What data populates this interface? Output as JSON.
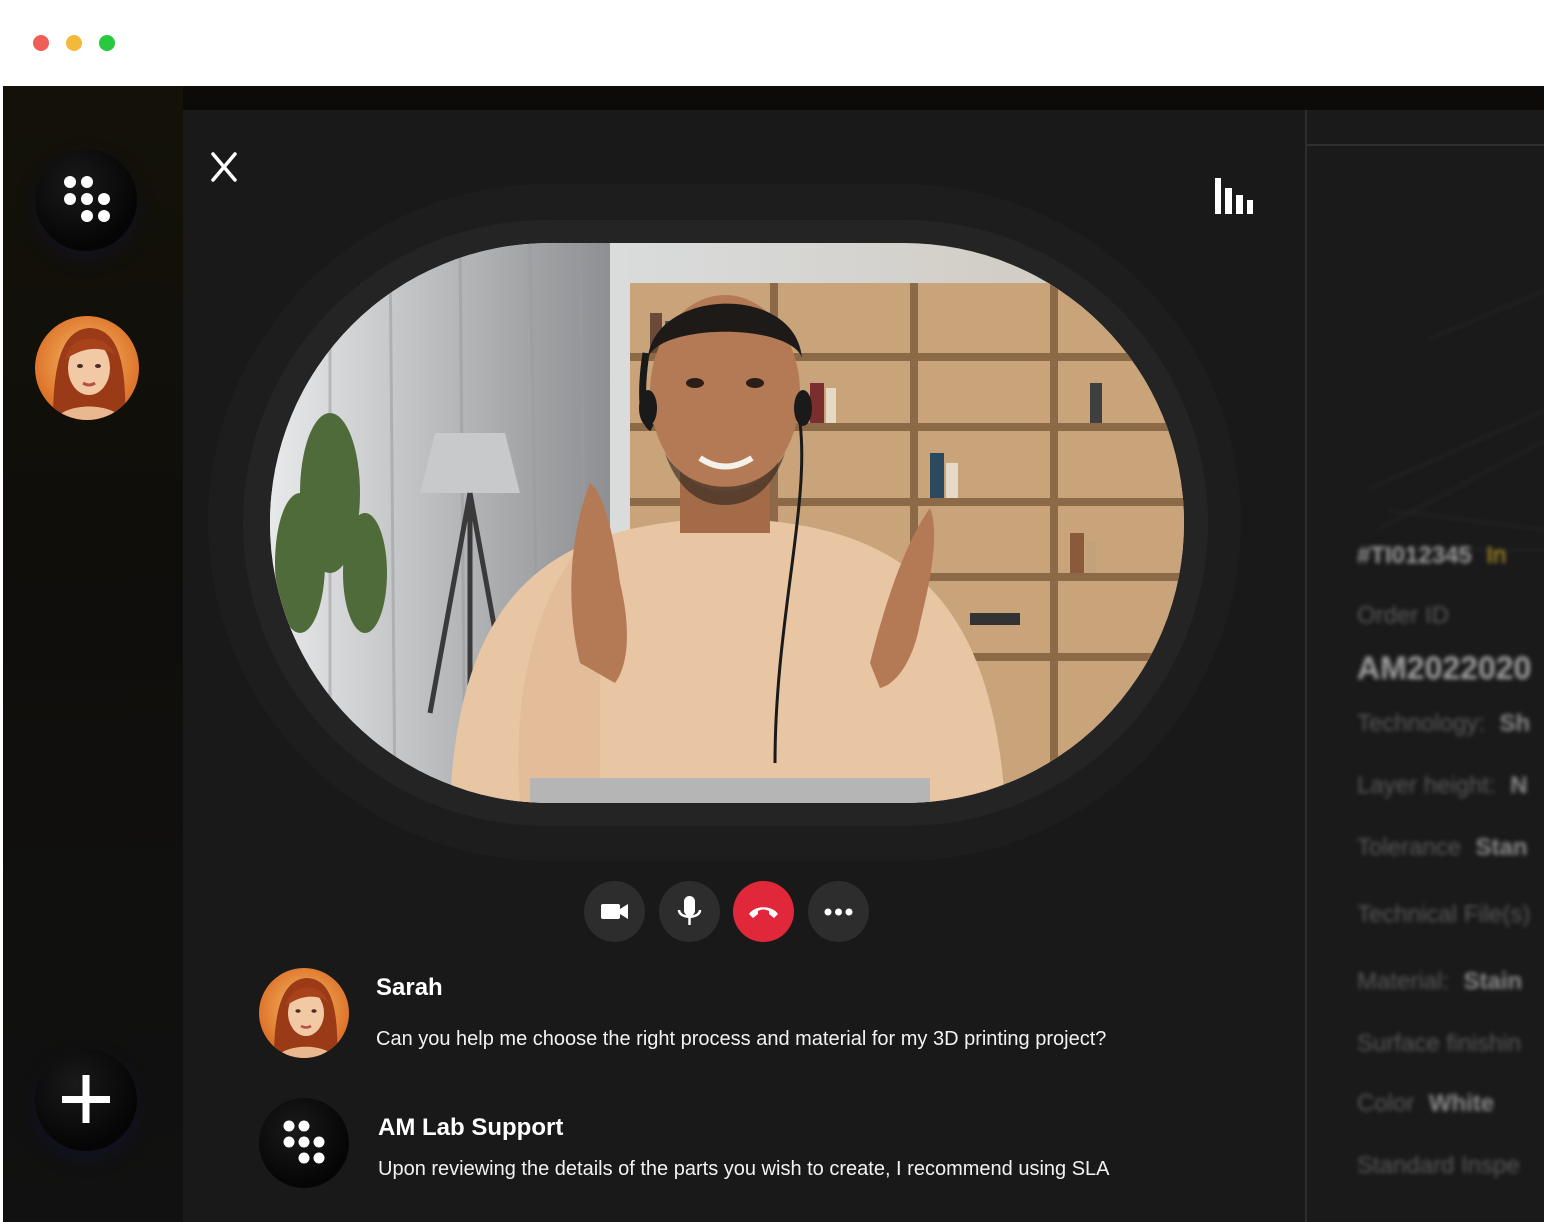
{
  "window": {
    "controls": [
      "close",
      "minimize",
      "maximize"
    ]
  },
  "sidebar": {
    "logo_icon": "dots-logo-icon",
    "contact_icon": "avatar-sarah",
    "add_icon": "plus-icon"
  },
  "call": {
    "close_icon": "close-icon",
    "stats_icon": "bar-chart-icon",
    "controls": [
      {
        "name": "camera",
        "icon": "video-camera-icon"
      },
      {
        "name": "mic",
        "icon": "microphone-icon"
      },
      {
        "name": "end-call",
        "icon": "phone-hangup-icon",
        "color": "#e0283a"
      },
      {
        "name": "more",
        "icon": "more-dots-icon"
      }
    ]
  },
  "chat": {
    "messages": [
      {
        "sender": "Sarah",
        "text": "Can you help me choose the right process and material for my 3D printing project?"
      },
      {
        "sender": "AM Lab Support",
        "text": "Upon reviewing the details of the parts you wish to create, I recommend using SLA"
      }
    ]
  },
  "order_panel": {
    "ticket_id": "#TI012345",
    "status": "In",
    "order_id_label": "Order ID",
    "order_id_value": "AM2022020",
    "technology_label": "Technology:",
    "technology_value": "Sh",
    "layer_height_label": "Layer height:",
    "layer_height_value": "N",
    "tolerance_label": "Tolerance",
    "tolerance_value": "Stan",
    "technical_files_label": "Technical File(s)",
    "material_label": "Material:",
    "material_value": "Stain",
    "surface_finishing_label": "Surface finishin",
    "color_label": "Color",
    "color_value": "White",
    "standard_inspection_label": "Standard Inspe"
  },
  "colors": {
    "accent": "#e0283a",
    "status": "#c9a227",
    "background": "#191919"
  }
}
